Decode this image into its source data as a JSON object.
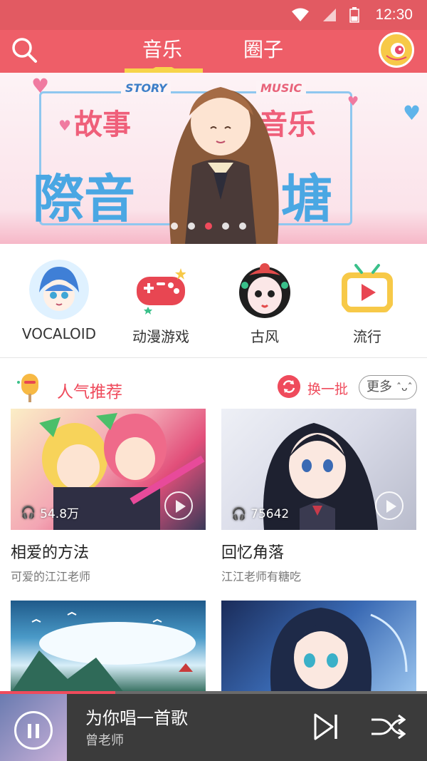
{
  "status_bar": {
    "time": "12:30",
    "icons": [
      "wifi-icon",
      "signal-icon",
      "battery-icon"
    ]
  },
  "header": {
    "tabs": [
      {
        "label": "音乐",
        "active": true
      },
      {
        "label": "圈子",
        "active": false
      }
    ],
    "icons": [
      "search-icon",
      "avatar"
    ]
  },
  "banner": {
    "story_word": "STORY",
    "music_word": "MUSIC",
    "title_left": "故事",
    "title_right": "音乐",
    "title_big_left": "際音",
    "title_big_right": "塘",
    "active_dot": 2,
    "dot_count": 5
  },
  "categories": [
    {
      "label": "VOCALOID",
      "icon": "vocaloid-avatar-icon"
    },
    {
      "label": "动漫游戏",
      "icon": "gamepad-icon"
    },
    {
      "label": "古风",
      "icon": "opera-mask-icon"
    },
    {
      "label": "流行",
      "icon": "tv-play-icon"
    }
  ],
  "recommend": {
    "title": "人气推荐",
    "swap_label": "换一批",
    "more_label": "更多"
  },
  "cards": [
    {
      "name": "相爱的方法",
      "author": "可爱的江江老师",
      "plays": "54.8万"
    },
    {
      "name": "回忆角落",
      "author": "江江老师有糖吃",
      "plays": "75642"
    },
    {
      "name": "",
      "author": "",
      "plays": ""
    },
    {
      "name": "",
      "author": "",
      "plays": ""
    }
  ],
  "player": {
    "song": "为你唱一首歌",
    "singer": "曾老师",
    "progress": 0.27
  },
  "colors": {
    "accent": "#ef4b5c",
    "header": "#ee5e68",
    "player_bg": "#3b3b3b"
  }
}
